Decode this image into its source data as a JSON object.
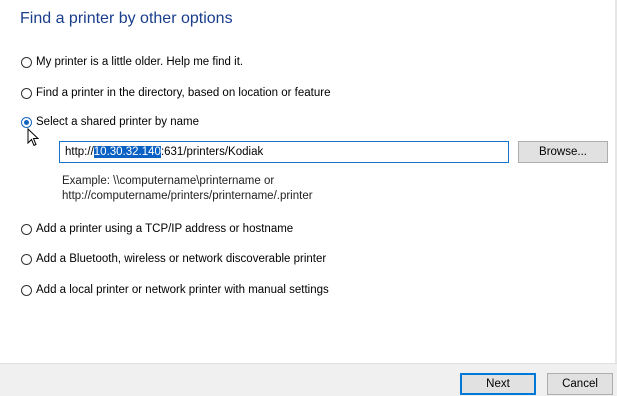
{
  "title": "Find a printer by other options",
  "options": [
    {
      "label": "My printer is a little older. Help me find it.",
      "checked": false
    },
    {
      "label": "Find a printer in the directory, based on location or feature",
      "checked": false
    },
    {
      "label": "Select a shared printer by name",
      "checked": true
    },
    {
      "label": "Add a printer using a TCP/IP address or hostname",
      "checked": false
    },
    {
      "label": "Add a Bluetooth, wireless or network discoverable printer",
      "checked": false
    },
    {
      "label": "Add a local printer or network printer with manual settings",
      "checked": false
    }
  ],
  "shared_printer": {
    "value_prefix": "http://",
    "value_selected": "10.30.32.140",
    "value_suffix": ":631/printers/Kodiak",
    "browse_label": "Browse...",
    "example_line1": "Example: \\\\computername\\printername or",
    "example_line2": "http://computername/printers/printername/.printer"
  },
  "footer": {
    "next_label": "Next",
    "cancel_label": "Cancel"
  },
  "colors": {
    "title": "#1a3e8c",
    "accent": "#0078d7",
    "selection": "#0b62c4"
  }
}
